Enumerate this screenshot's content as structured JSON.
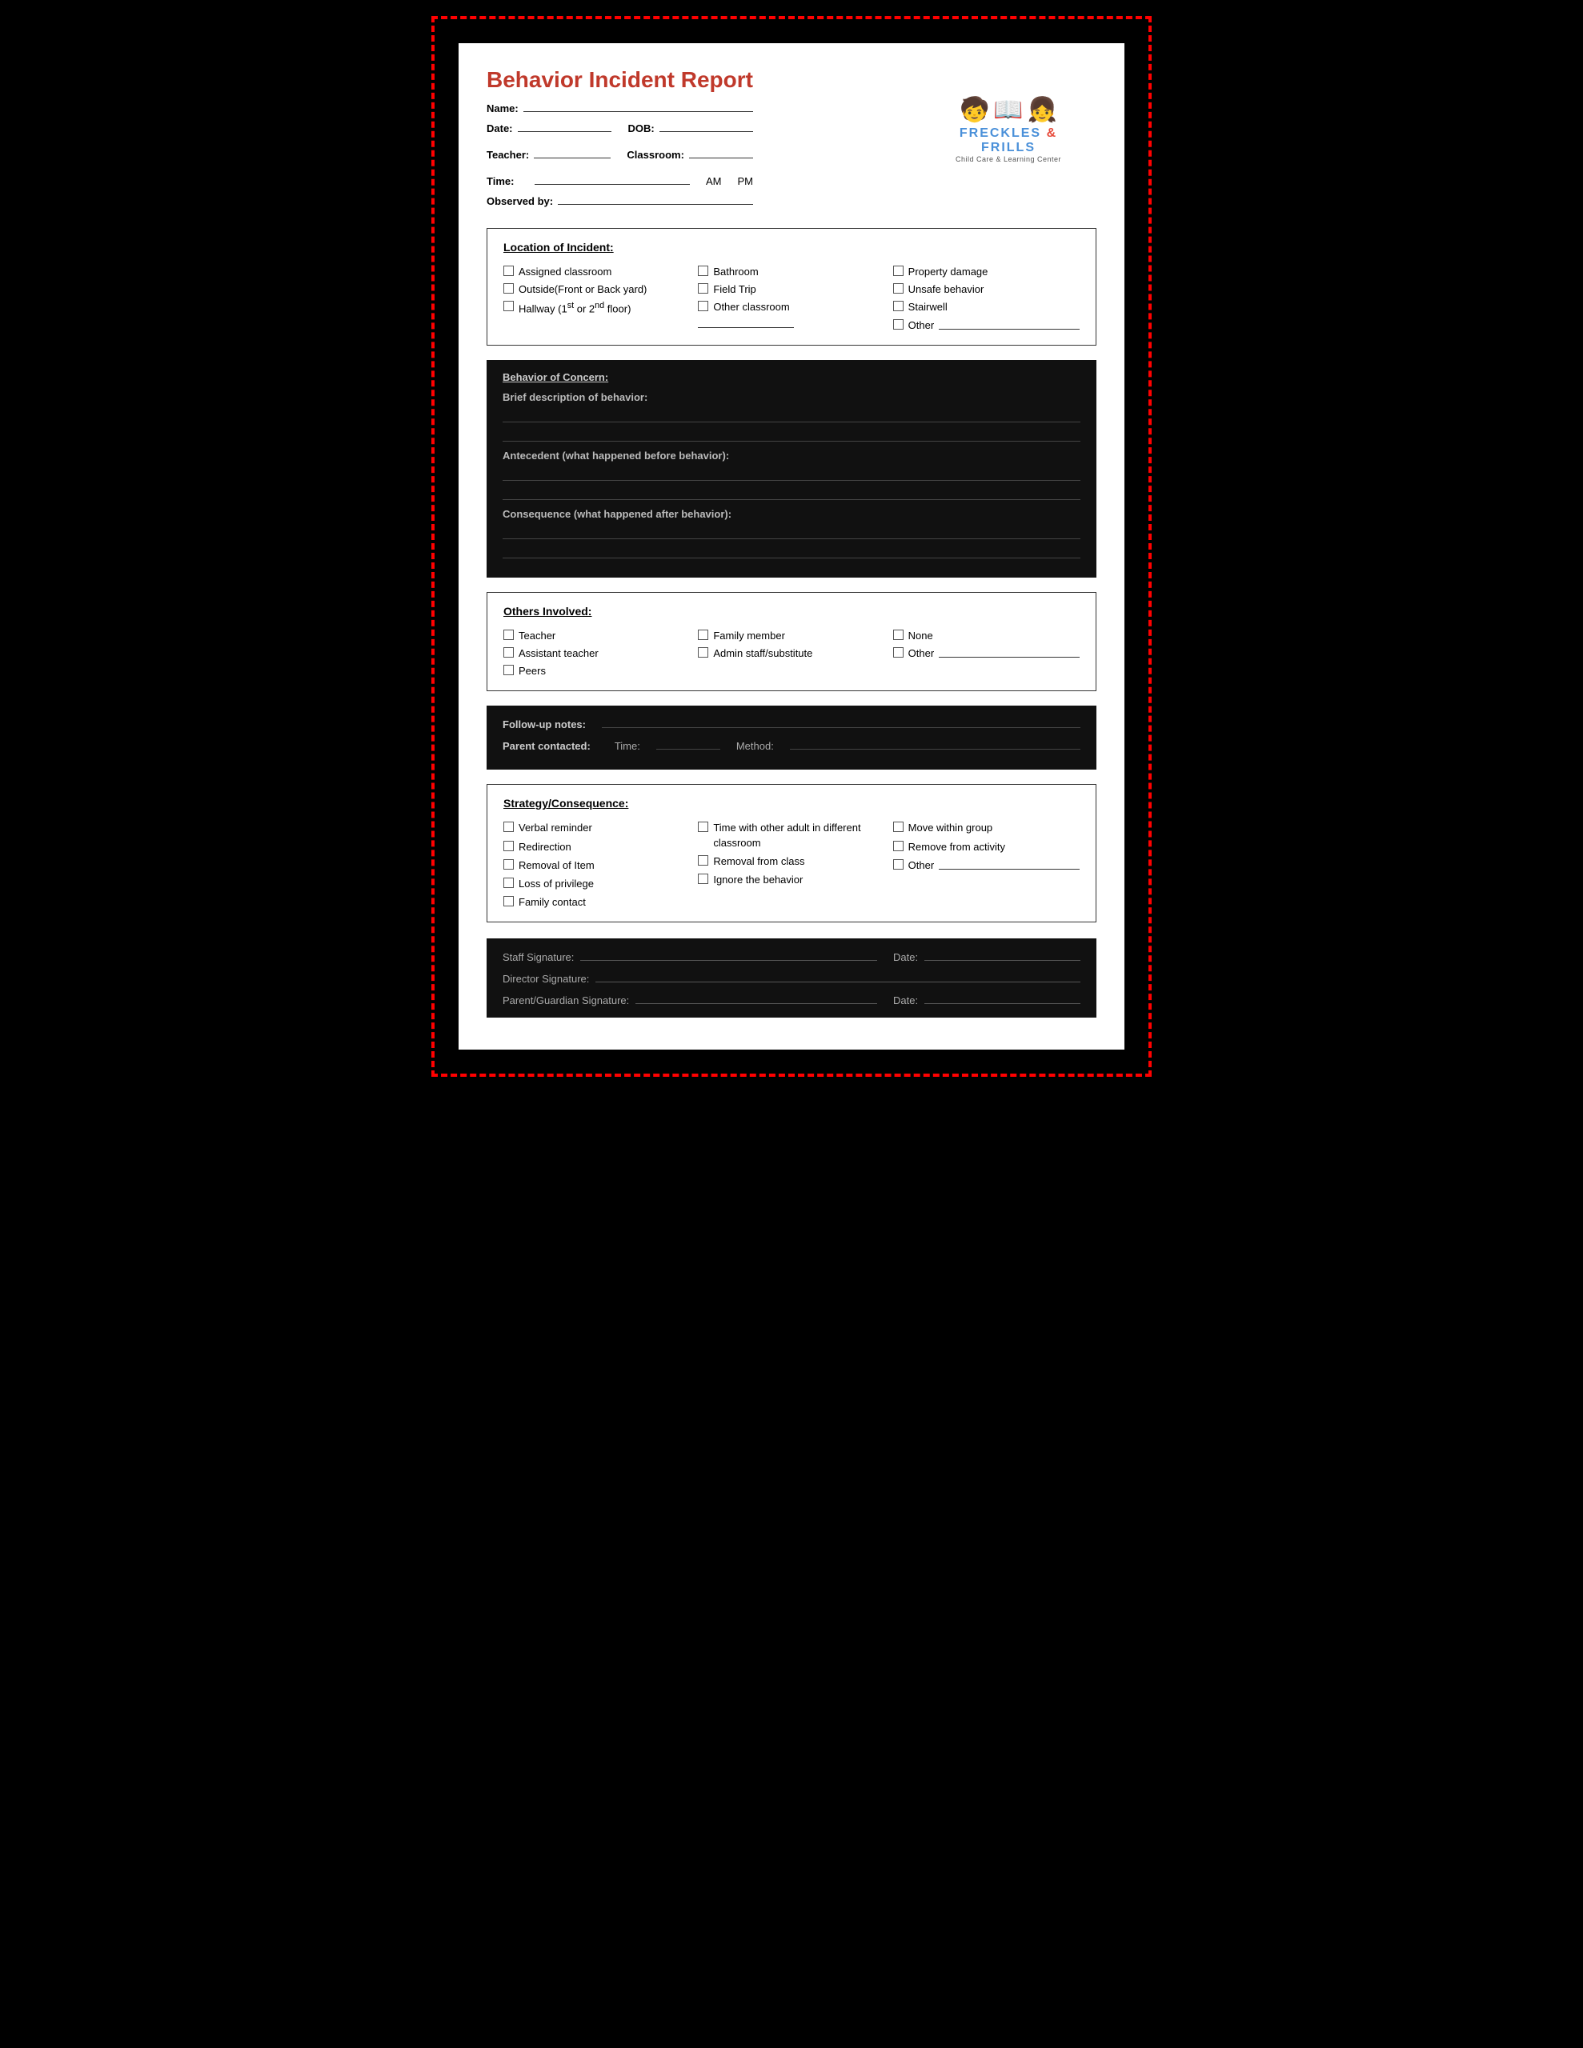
{
  "page": {
    "title": "Behavior Incident Report",
    "logo": {
      "line1": "FRECKLES",
      "ampersand": "&",
      "line2": "FRILLS",
      "subtitle": "Child Care & Learning Center",
      "icon1": "👦",
      "icon2": "📚",
      "icon3": "👧"
    }
  },
  "header_fields": {
    "name_label": "Name:",
    "date_label": "Date:",
    "dob_label": "DOB:",
    "teacher_label": "Teacher:",
    "classroom_label": "Classroom:",
    "time_label": "Time:",
    "am_label": "AM",
    "pm_label": "PM",
    "observed_by_label": "Observed by:"
  },
  "location_section": {
    "title": "Location of Incident:",
    "col1": [
      "Assigned classroom",
      "Outside(Front or Back yard)",
      "Hallway (1st or 2nd floor)"
    ],
    "col2": [
      "Bathroom",
      "Field Trip",
      "Other classroom"
    ],
    "col3": [
      "Property damage",
      "Unsafe behavior",
      "Stairwell",
      "Other"
    ]
  },
  "behavior_section": {
    "title": "Behavior of Concern:",
    "description_label": "Brief description of behavior:",
    "antecedent_label": "Antecedent (what happened before behavior):",
    "consequence_label": "Consequence (what happened after behavior):"
  },
  "others_section": {
    "title": "Others Involved:",
    "col1": [
      "Teacher",
      "Assistant teacher",
      "Peers"
    ],
    "col2": [
      "Family member",
      "Admin staff/substitute"
    ],
    "col3": [
      "None",
      "Other"
    ]
  },
  "strategy_section": {
    "title": "Strategy/Consequence:",
    "col1": [
      "Verbal reminder",
      "Redirection",
      "Removal of Item",
      "Loss of privilege",
      "Family contact"
    ],
    "col2": [
      "Time with other adult in different classroom",
      "Removal from class",
      "Ignore the behavior"
    ],
    "col3": [
      "Move within group",
      "Remove from activity",
      "Other"
    ]
  },
  "signature_section": {
    "staff_sig_label": "Staff Signature:",
    "date_label": "Date:",
    "director_sig_label": "Director Signature:",
    "parent_sig_label": "Parent/Guardian Signature:",
    "parent_date_label": "Date:"
  },
  "followup_section": {
    "label1": "Follow-up notes:",
    "label2": "Parent contacted:",
    "time_label": "Time:",
    "method_label": "Method:"
  }
}
